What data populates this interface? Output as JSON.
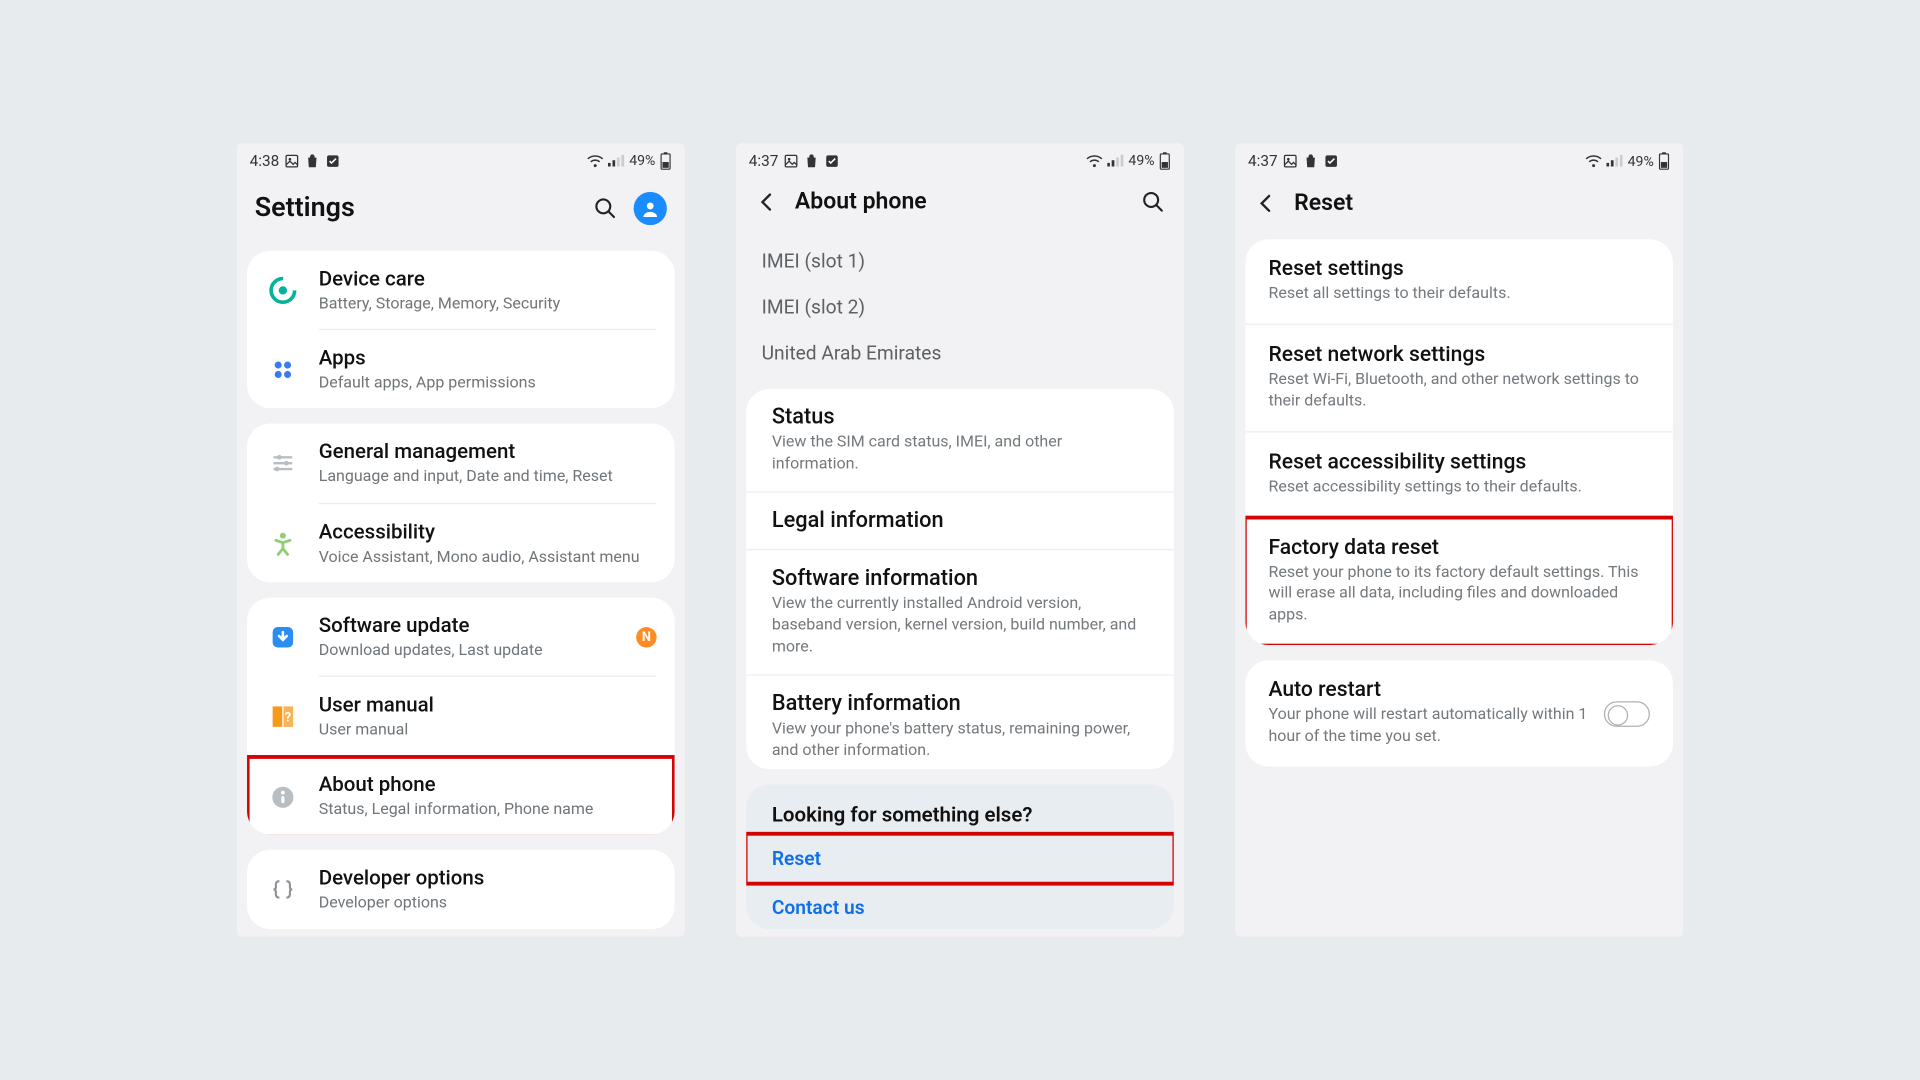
{
  "statusbars": [
    {
      "time": "4:38",
      "battery": "49%"
    },
    {
      "time": "4:37",
      "battery": "49%"
    },
    {
      "time": "4:37",
      "battery": "49%"
    }
  ],
  "screen1": {
    "title": "Settings",
    "groups": [
      [
        {
          "title": "Device care",
          "sub": "Battery, Storage, Memory, Security"
        },
        {
          "title": "Apps",
          "sub": "Default apps, App permissions"
        }
      ],
      [
        {
          "title": "General management",
          "sub": "Language and input, Date and time, Reset"
        },
        {
          "title": "Accessibility",
          "sub": "Voice Assistant, Mono audio, Assistant menu"
        }
      ],
      [
        {
          "title": "Software update",
          "sub": "Download updates, Last update",
          "badge": "N"
        },
        {
          "title": "User manual",
          "sub": "User manual"
        },
        {
          "title": "About phone",
          "sub": "Status, Legal information, Phone name",
          "highlight": true
        }
      ],
      [
        {
          "title": "Developer options",
          "sub": "Developer options"
        }
      ]
    ]
  },
  "screen2": {
    "title": "About phone",
    "top_list": [
      "IMEI (slot 1)",
      "IMEI (slot 2)",
      "United Arab Emirates"
    ],
    "sections": [
      {
        "title": "Status",
        "sub": "View the SIM card status, IMEI, and other information."
      },
      {
        "title": "Legal information",
        "sub": ""
      },
      {
        "title": "Software information",
        "sub": "View the currently installed Android version, baseband version, kernel version, build number, and more."
      },
      {
        "title": "Battery information",
        "sub": "View your phone's battery status, remaining power, and other information."
      }
    ],
    "looking": {
      "title": "Looking for something else?",
      "links": [
        {
          "label": "Reset",
          "highlight": true
        },
        {
          "label": "Contact us",
          "highlight": false
        }
      ]
    }
  },
  "screen3": {
    "title": "Reset",
    "items": [
      {
        "title": "Reset settings",
        "sub": "Reset all settings to their defaults."
      },
      {
        "title": "Reset network settings",
        "sub": "Reset Wi-Fi, Bluetooth, and other network settings to their defaults."
      },
      {
        "title": "Reset accessibility settings",
        "sub": "Reset accessibility settings to their defaults."
      },
      {
        "title": "Factory data reset",
        "sub": "Reset your phone to its factory default settings. This will erase all data, including files and downloaded apps.",
        "highlight": true
      }
    ],
    "auto": {
      "title": "Auto restart",
      "sub": "Your phone will restart automatically within 1 hour of the time you set."
    }
  }
}
